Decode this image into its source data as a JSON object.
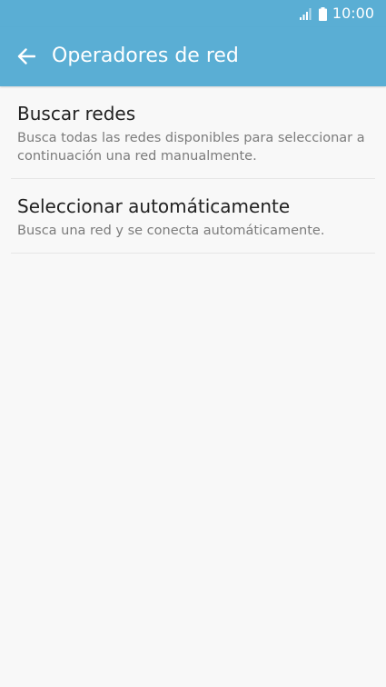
{
  "status_bar": {
    "time": "10:00",
    "icons": [
      "signal-icon",
      "battery-icon"
    ]
  },
  "app_bar": {
    "title": "Operadores de red",
    "back_icon": "arrow-back-icon"
  },
  "list": {
    "items": [
      {
        "title": "Buscar redes",
        "subtitle": "Busca todas las redes disponibles para seleccionar a continuación una red manualmente."
      },
      {
        "title": "Seleccionar automáticamente",
        "subtitle": "Busca una red y se conecta automáticamente."
      }
    ]
  },
  "colors": {
    "accent": "#5aaed4",
    "background": "#f8f8f8",
    "title_text": "#212121",
    "subtitle_text": "#7b7b7b",
    "divider": "#e6e6e6"
  }
}
